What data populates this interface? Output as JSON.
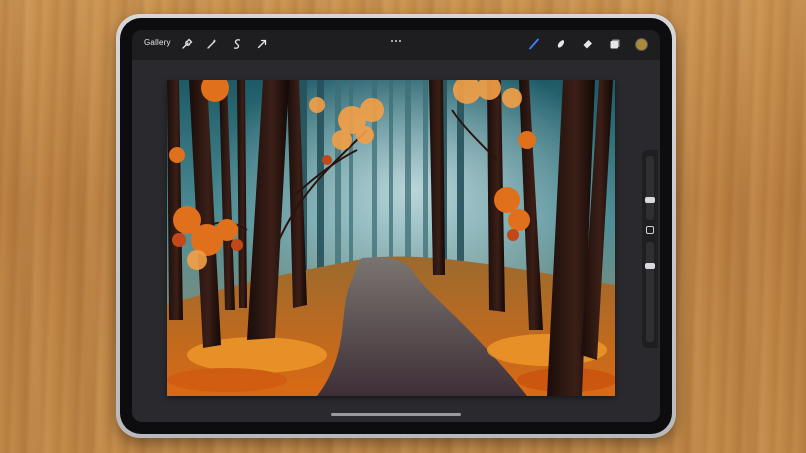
{
  "toolbar": {
    "gallery_label": "Gallery",
    "left_tools": [
      "wrench-icon",
      "magic-wand-icon",
      "selection-icon",
      "transform-arrow-icon"
    ],
    "right_tools": [
      "brush-icon",
      "smudge-icon",
      "eraser-icon",
      "layers-icon"
    ],
    "current_color": "#a88a3c"
  },
  "sidebar": {
    "brush_size_level": 0.3,
    "opacity_level": 0.78
  },
  "colors": {
    "toolbar_bg": "#1e1e21",
    "accent": "#3d7fff"
  }
}
